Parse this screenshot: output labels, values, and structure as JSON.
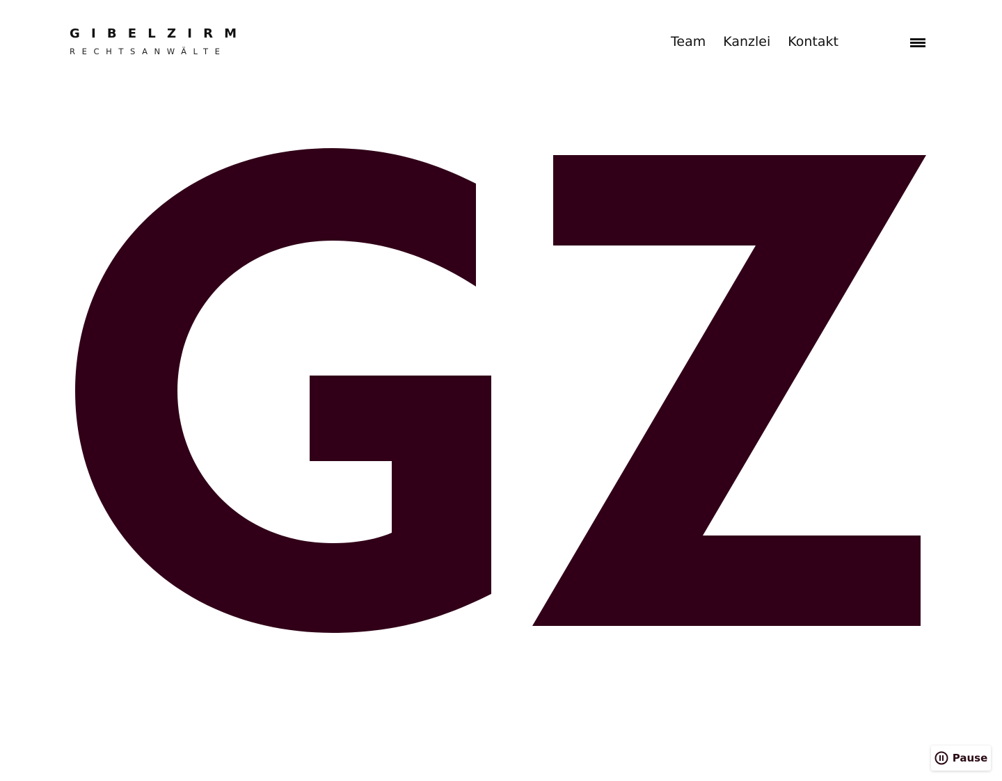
{
  "header": {
    "logo": {
      "name": "GIBELZIRM",
      "subtitle": "RECHTSANWÄLTE"
    },
    "nav": [
      {
        "label": "Team"
      },
      {
        "label": "Kanzlei"
      },
      {
        "label": "Kontakt"
      }
    ],
    "menu_icon": "hamburger-menu-icon"
  },
  "hero": {
    "monogram": "GZ",
    "color": "#310018"
  },
  "media_control": {
    "pause_label": "Pause",
    "icon": "pause-icon"
  }
}
